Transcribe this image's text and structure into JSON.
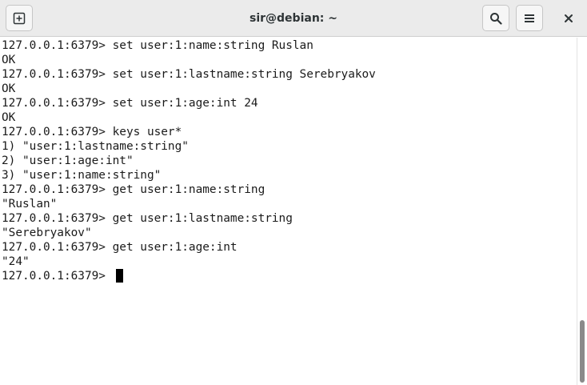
{
  "window": {
    "title": "sir@debian: ~"
  },
  "titlebar": {
    "new_tab_icon": "new-tab-icon",
    "search_icon": "search-icon",
    "menu_icon": "hamburger-menu-icon",
    "close_icon": "close-icon"
  },
  "terminal": {
    "lines": [
      "127.0.0.1:6379> set user:1:name:string Ruslan",
      "OK",
      "127.0.0.1:6379> set user:1:lastname:string Serebryakov",
      "OK",
      "127.0.0.1:6379> set user:1:age:int 24",
      "OK",
      "127.0.0.1:6379> keys user*",
      "1) \"user:1:lastname:string\"",
      "2) \"user:1:age:int\"",
      "3) \"user:1:name:string\"",
      "127.0.0.1:6379> get user:1:name:string",
      "\"Ruslan\"",
      "127.0.0.1:6379> get user:1:lastname:string",
      "\"Serebryakov\"",
      "127.0.0.1:6379> get user:1:age:int",
      "\"24\"",
      "127.0.0.1:6379> "
    ]
  },
  "colors": {
    "titlebar_bg": "#ebebeb",
    "terminal_bg": "#ffffff",
    "terminal_fg": "#1a1a1a",
    "cursor": "#000000"
  }
}
